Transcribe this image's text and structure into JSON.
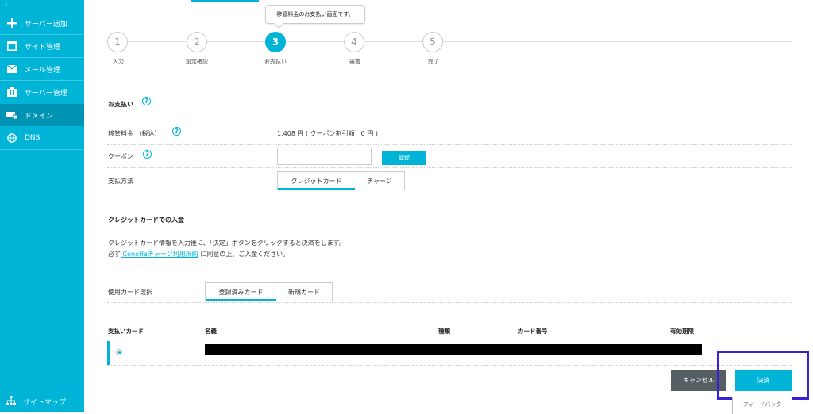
{
  "sidebar": {
    "collapse_label": "‹",
    "items": [
      {
        "label": "サーバー追加",
        "icon": "plus-icon"
      },
      {
        "label": "サイト管理",
        "icon": "window-icon"
      },
      {
        "label": "メール管理",
        "icon": "mail-icon"
      },
      {
        "label": "サーバー管理",
        "icon": "server-icon"
      },
      {
        "label": "ドメイン",
        "icon": "domain-icon"
      },
      {
        "label": "DNS",
        "icon": "globe-icon"
      }
    ],
    "active": "ドメイン",
    "sitemap_label": "サイトマップ"
  },
  "tooltip": "移管料金のお支払い画面です。",
  "steps": [
    {
      "num": "1",
      "label": "入力"
    },
    {
      "num": "2",
      "label": "設定確認"
    },
    {
      "num": "3",
      "label": "お支払い"
    },
    {
      "num": "4",
      "label": "審査"
    },
    {
      "num": "5",
      "label": "完了"
    }
  ],
  "current_step": "3",
  "payment": {
    "heading": "お支払い",
    "fee_label": "移管料金 （税込）",
    "fee_value": "1,408 円 ( クーポン割引額　0 円 )",
    "coupon_label": "クーポン",
    "coupon_value": "",
    "register_button": "登録",
    "method_label": "支払方法",
    "method_tabs": [
      "クレジットカード",
      "チャージ"
    ],
    "method_selected": "クレジットカード"
  },
  "credit": {
    "heading": "クレジットカードでの入金",
    "line1": "クレジットカード情報を入力後に、「決定」ボタンをクリックすると決済をします。",
    "line2_prefix": "必ず",
    "line2_link": " ConoHaチャージ利用規約",
    "line2_suffix": " に同意の上、ご入金ください。",
    "card_select_label": "使用カード選択",
    "card_tabs": [
      "登録済みカード",
      "新規カード"
    ],
    "card_selected": "登録済みカード"
  },
  "table": {
    "headers": [
      "支払いカード",
      "名義",
      "種類",
      "カード番号",
      "有効期限"
    ]
  },
  "actions": {
    "cancel": "キャンセル",
    "confirm": "決済",
    "feedback": "フィードバック"
  },
  "colors": {
    "accent": "#00b4d8",
    "sidebar_active": "#0093b3",
    "cancel_bg": "#555e63",
    "annotation": "#3a1fd6"
  }
}
